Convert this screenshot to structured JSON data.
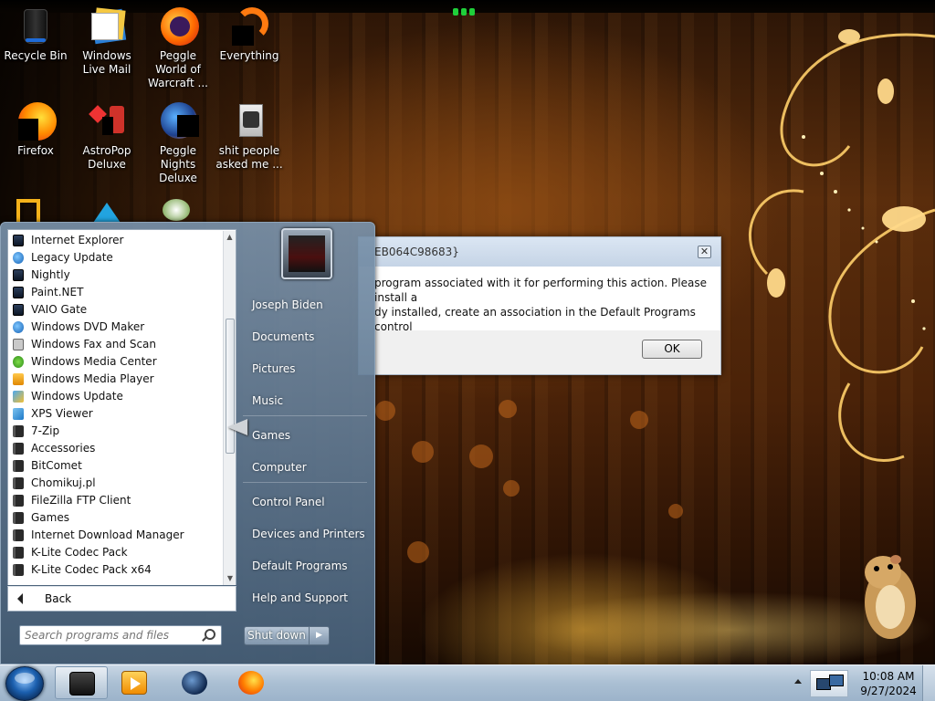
{
  "desktop": {
    "icons": [
      {
        "label": "Recycle Bin",
        "icon": "recycle-bin-icon"
      },
      {
        "label": "Windows Live Mail",
        "icon": "windows-live-mail-icon"
      },
      {
        "label": "Peggle World of Warcraft ...",
        "icon": "peggle-wow-icon"
      },
      {
        "label": "Everything",
        "icon": "everything-icon"
      },
      {
        "label": "Firefox",
        "icon": "firefox-icon"
      },
      {
        "label": "AstroPop Deluxe",
        "icon": "astropop-icon"
      },
      {
        "label": "Peggle Nights Deluxe",
        "icon": "peggle-nights-icon"
      },
      {
        "label": "shit people asked me ...",
        "icon": "text-file-icon"
      }
    ]
  },
  "dialog": {
    "title": "EB064C98683}",
    "message": "program associated with it for performing this action. Please install a\ndy installed, create an association in the Default Programs control",
    "ok_label": "OK",
    "close_label": "✕"
  },
  "startmenu": {
    "programs": [
      {
        "label": "Internet Explorer",
        "icon": "app"
      },
      {
        "label": "Legacy Update",
        "icon": "globe"
      },
      {
        "label": "Nightly",
        "icon": "app"
      },
      {
        "label": "Paint.NET",
        "icon": "app"
      },
      {
        "label": "VAIO Gate",
        "icon": "app"
      },
      {
        "label": "Windows DVD Maker",
        "icon": "globe"
      },
      {
        "label": "Windows Fax and Scan",
        "icon": "fax"
      },
      {
        "label": "Windows Media Center",
        "icon": "media"
      },
      {
        "label": "Windows Media Player",
        "icon": "player"
      },
      {
        "label": "Windows Update",
        "icon": "update"
      },
      {
        "label": "XPS Viewer",
        "icon": "xps"
      },
      {
        "label": "7-Zip",
        "icon": "folder"
      },
      {
        "label": "Accessories",
        "icon": "folder"
      },
      {
        "label": "BitComet",
        "icon": "folder"
      },
      {
        "label": "Chomikuj.pl",
        "icon": "folder"
      },
      {
        "label": "FileZilla FTP Client",
        "icon": "folder"
      },
      {
        "label": "Games",
        "icon": "folder"
      },
      {
        "label": "Internet Download Manager",
        "icon": "folder"
      },
      {
        "label": "K-Lite Codec Pack",
        "icon": "folder"
      },
      {
        "label": "K-Lite Codec Pack x64",
        "icon": "folder"
      }
    ],
    "back_label": "Back",
    "search_placeholder": "Search programs and files",
    "right_items": [
      "Joseph Biden",
      "Documents",
      "Pictures",
      "Music",
      "Games",
      "Computer",
      "Control Panel",
      "Devices and Printers",
      "Default Programs",
      "Help and Support"
    ],
    "shutdown_label": "Shut down",
    "shutdown_arrow": "▶"
  },
  "taskbar": {
    "pinned": [
      {
        "name": "explorer-taskbar-button",
        "icon": "explorer-icon"
      },
      {
        "name": "media-player-taskbar-button",
        "icon": "media-player-icon"
      },
      {
        "name": "app-globe-taskbar-button",
        "icon": "globe-icon"
      },
      {
        "name": "firefox-taskbar-button",
        "icon": "firefox-icon"
      }
    ],
    "clock_time": "10:08 AM",
    "clock_date": "9/27/2024"
  },
  "colors": {
    "accent": "#1b5fae",
    "startmenu_bg": "#5f7d99",
    "taskbar_bg": "#aabfd3",
    "wallpaper_glow": "#ffb43c"
  }
}
